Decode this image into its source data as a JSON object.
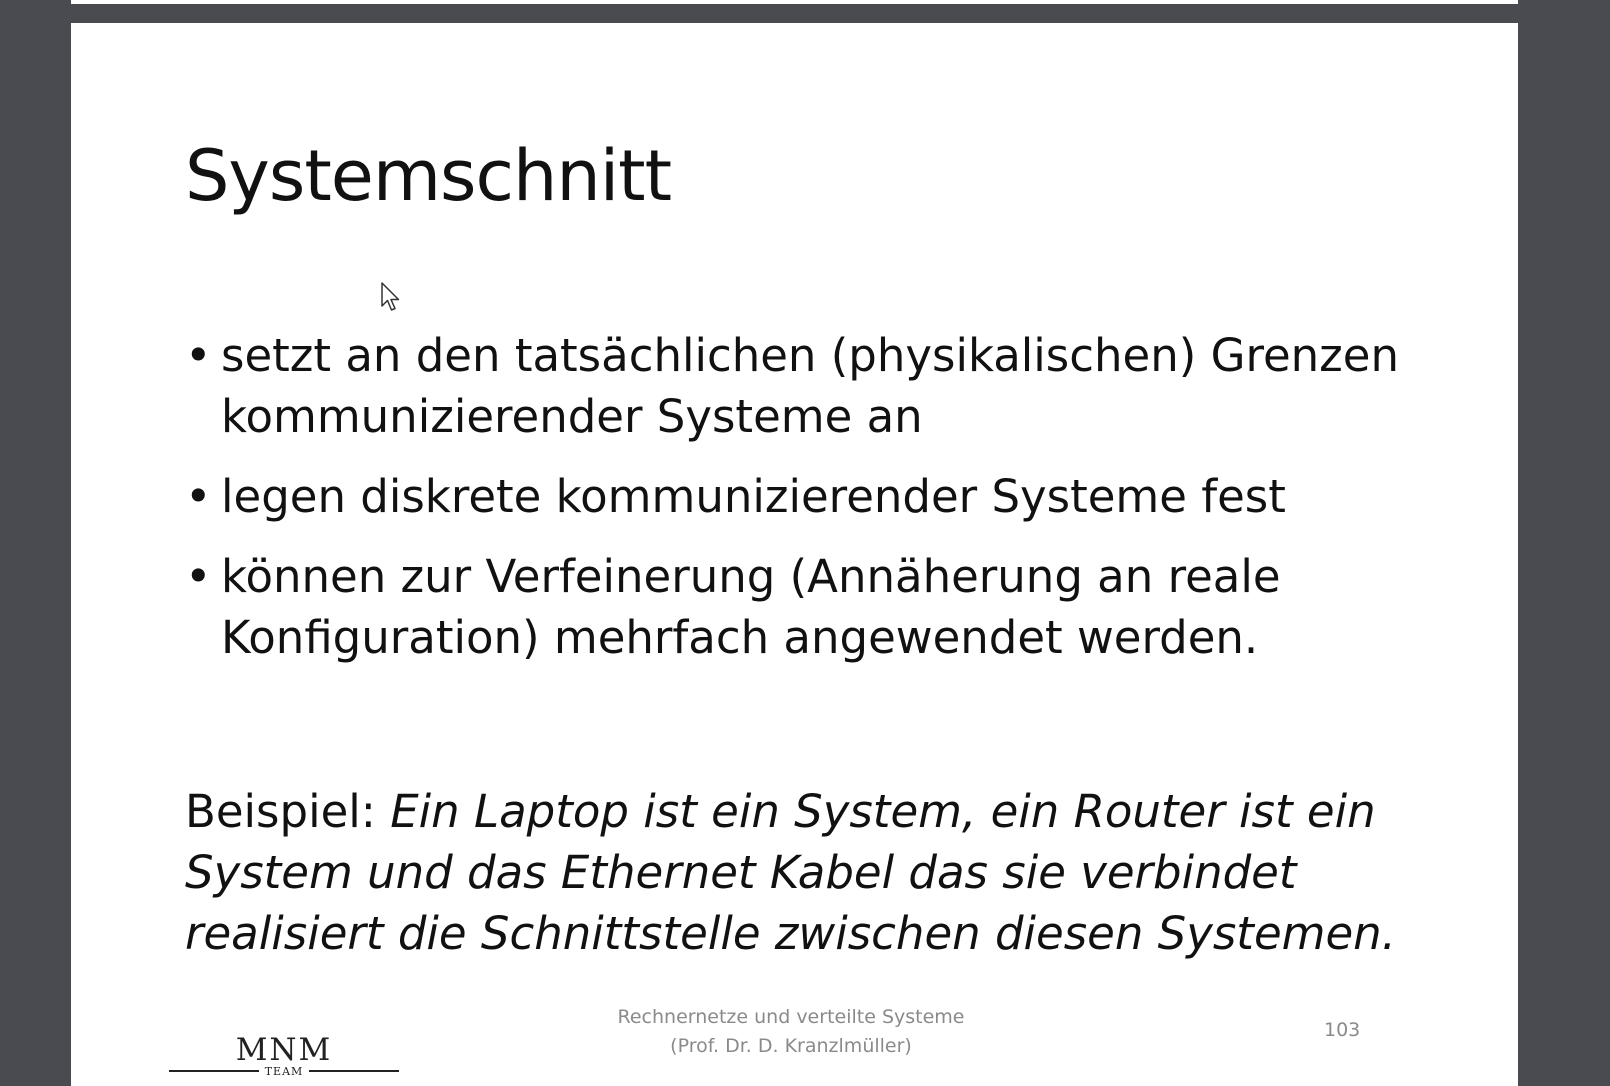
{
  "slide": {
    "title": "Systemschnitt",
    "bullets": [
      "setzt an den tatsächlichen (physikalischen) Grenzen kommunizierender Systeme an",
      "legen diskrete kommunizierender Systeme fest",
      "können zur Verfeinerung (Annäherung an reale Konfiguration) mehrfach angewendet werden."
    ],
    "bullet_glyph": "•",
    "example": {
      "label": "Beispiel: ",
      "text": "Ein Laptop ist ein System, ein Router ist ein System und das Ethernet Kabel das sie verbindet realisiert die Schnittstelle zwischen diesen Systemen."
    },
    "footer": {
      "logo_text": "MNM",
      "logo_sub": "TEAM",
      "course": "Rechnernetze und verteilte Systeme",
      "lecturer": "(Prof. Dr. D. Kranzlmüller)",
      "page_number": "103"
    }
  },
  "colors": {
    "background": "#4a4b50",
    "slide": "#ffffff",
    "text": "#111111",
    "footer_text": "#8a8a8a"
  },
  "icons": {
    "cursor": "mouse-pointer-icon"
  }
}
